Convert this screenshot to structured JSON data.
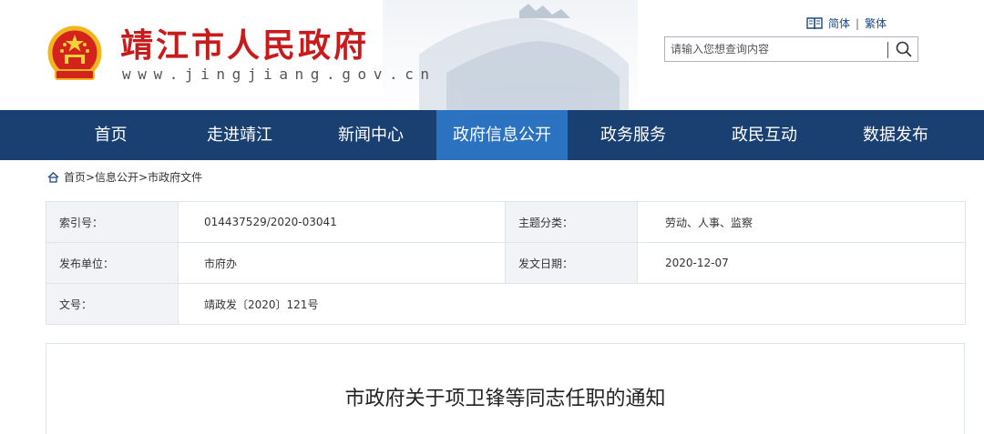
{
  "header": {
    "site_name": "靖江市人民政府",
    "site_url": "www.jingjiang.gov.cn",
    "lang": {
      "simplified": "简体",
      "separator": "|",
      "traditional": "繁体"
    },
    "search": {
      "placeholder": "请输入您想查询内容",
      "value": ""
    },
    "icons": {
      "emblem": "national-emblem-icon",
      "book": "book-icon",
      "search": "search-icon"
    },
    "colors": {
      "site_name": "#c81b1b",
      "nav_bg": "#1a3f71",
      "nav_active": "#2b72c1"
    }
  },
  "nav": {
    "items": [
      {
        "label": "首页"
      },
      {
        "label": "走进靖江"
      },
      {
        "label": "新闻中心"
      },
      {
        "label": "政府信息公开",
        "active": true
      },
      {
        "label": "政务服务"
      },
      {
        "label": "政民互动"
      },
      {
        "label": "数据发布"
      }
    ]
  },
  "breadcrumb": {
    "icon": "home-icon",
    "text": "首页>信息公开>市政府文件"
  },
  "info": {
    "index_label": "索引号：",
    "index_value": "014437529/2020-03041",
    "topic_label": "主题分类：",
    "topic_value": "劳动、人事、监察",
    "publisher_label": "发布单位：",
    "publisher_value": "市府办",
    "date_label": "发文日期：",
    "date_value": "2020-12-07",
    "docno_label": "文号：",
    "docno_value": "靖政发〔2020〕121号"
  },
  "article": {
    "title": "市政府关于项卫锋等同志任职的通知"
  }
}
